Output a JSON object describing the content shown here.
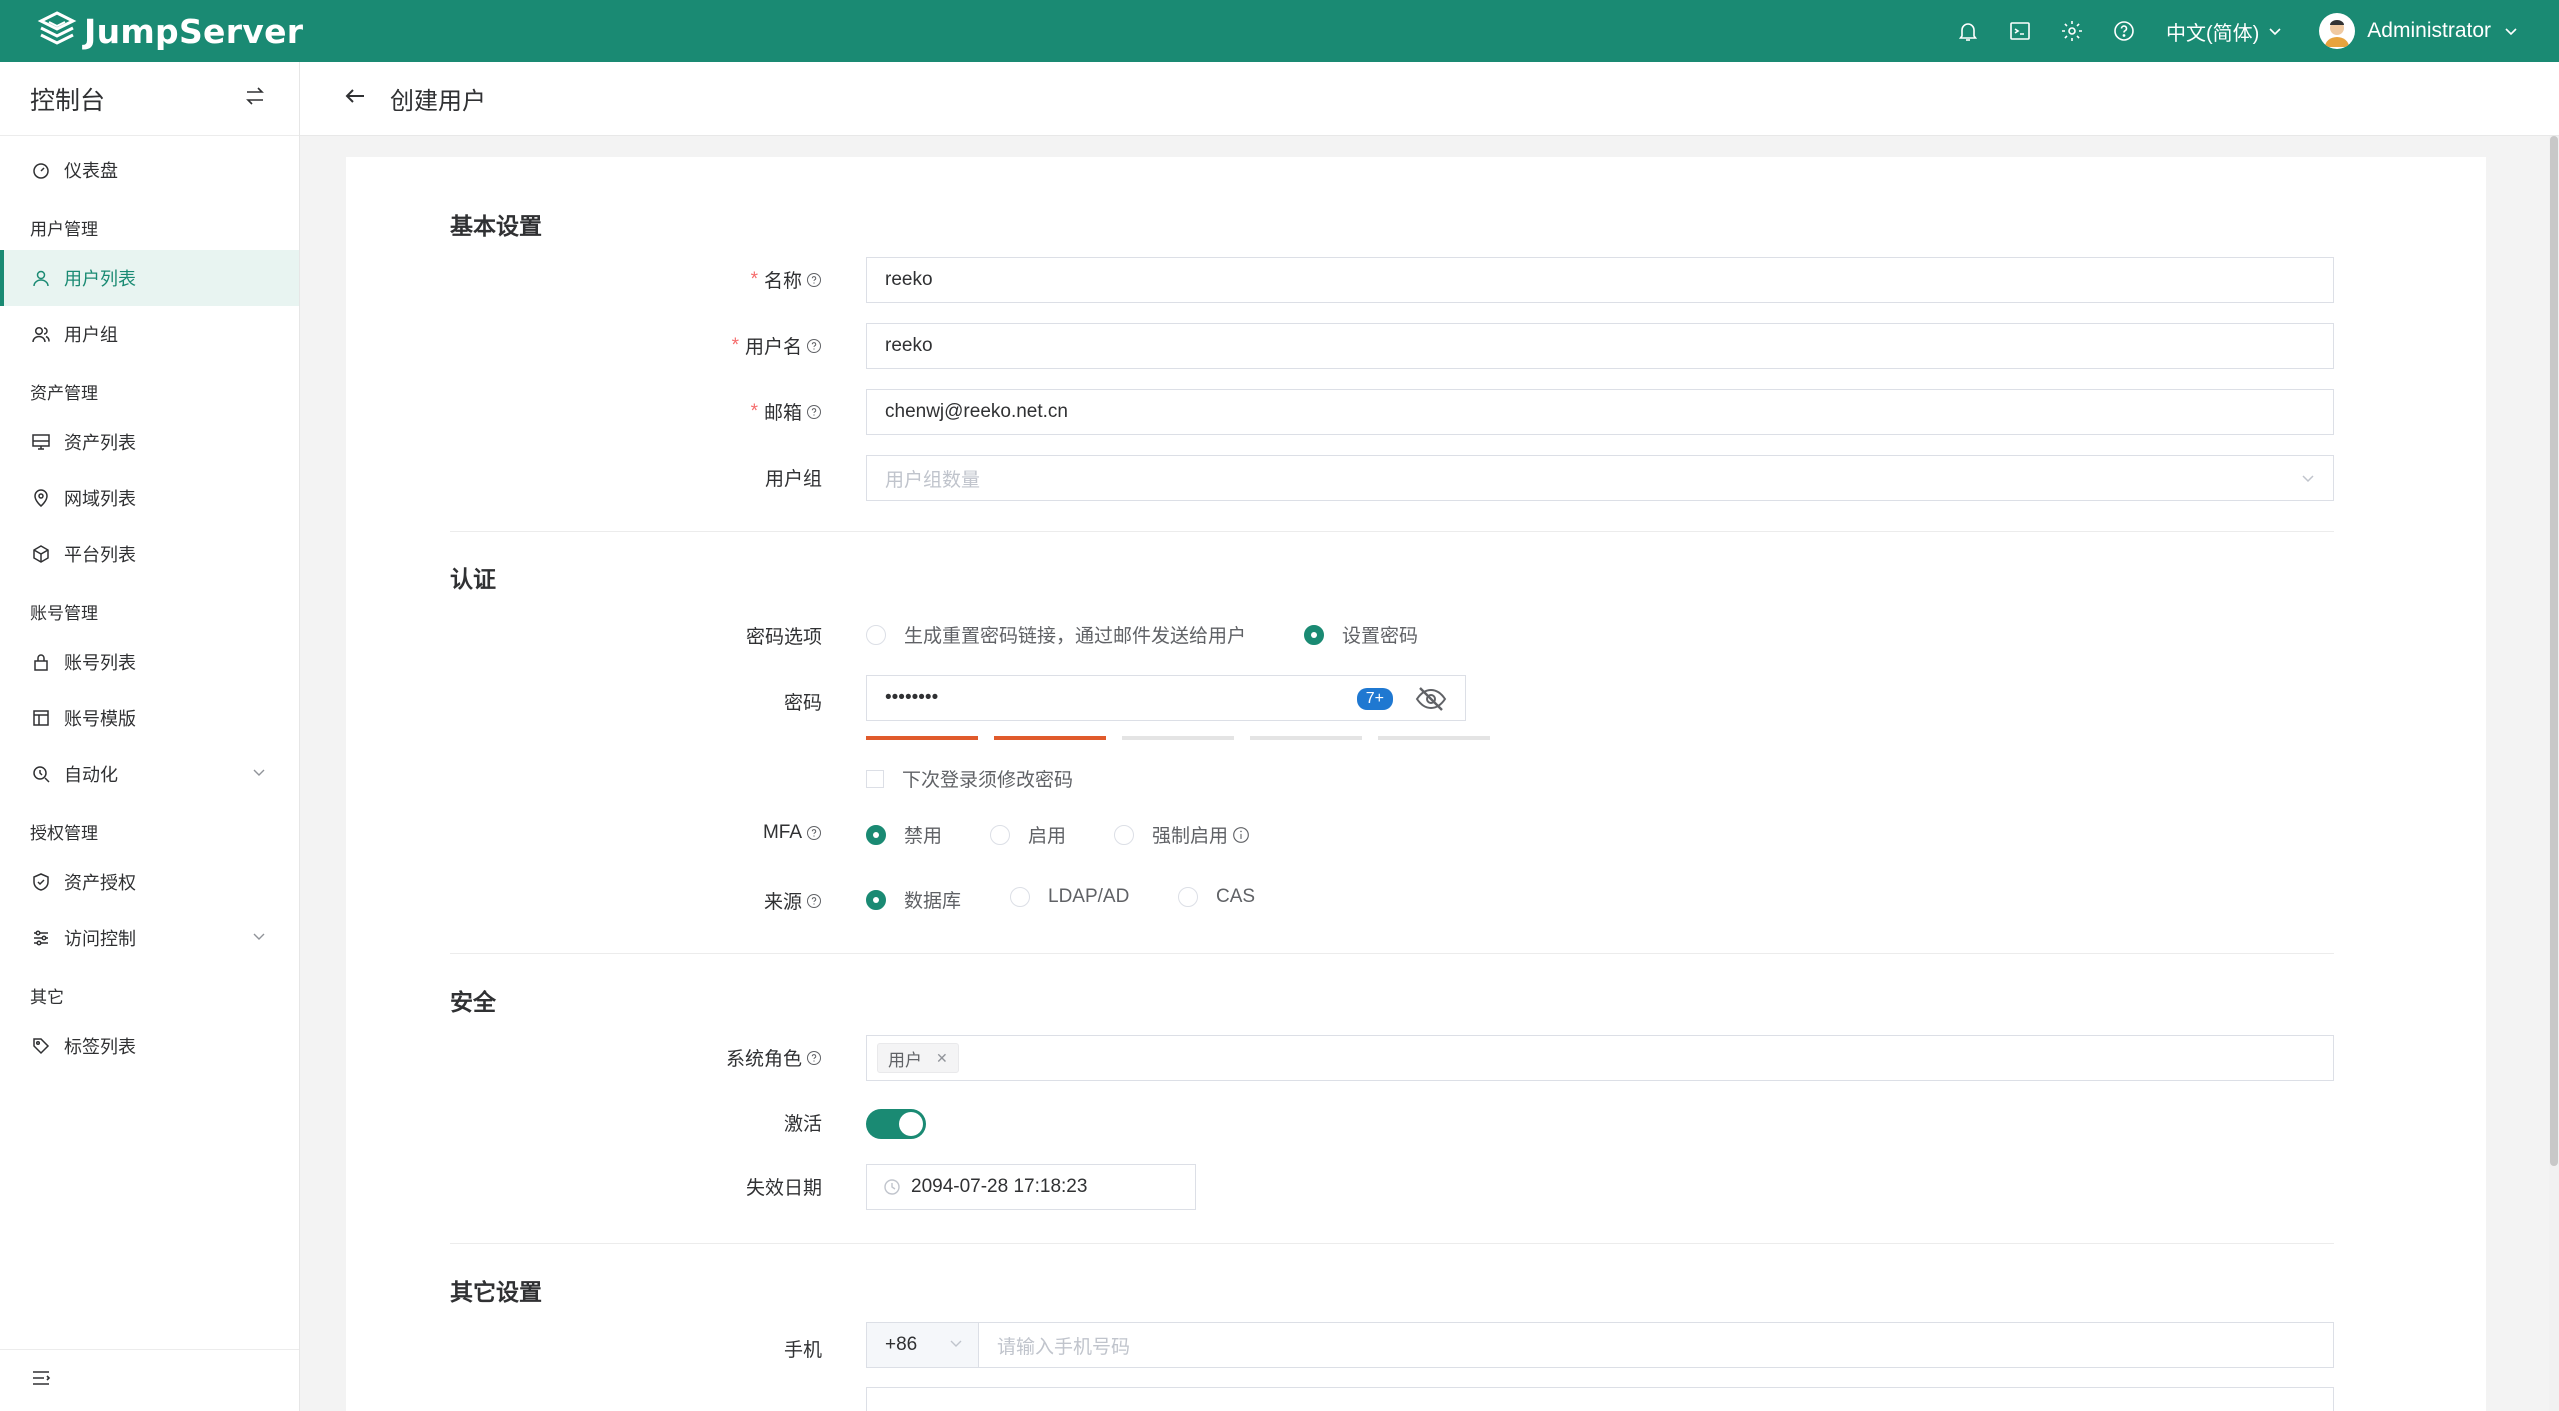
{
  "brand": {
    "name": "JumpServer"
  },
  "topbar": {
    "language": "中文(简体)",
    "username": "Administrator"
  },
  "sidebar": {
    "title": "控制台",
    "items": [
      {
        "type": "item",
        "label": "仪表盘",
        "icon": "dashboard-icon"
      },
      {
        "type": "group",
        "label": "用户管理"
      },
      {
        "type": "item",
        "label": "用户列表",
        "icon": "user-icon",
        "active": true
      },
      {
        "type": "item",
        "label": "用户组",
        "icon": "users-icon"
      },
      {
        "type": "group",
        "label": "资产管理"
      },
      {
        "type": "item",
        "label": "资产列表",
        "icon": "monitor-icon"
      },
      {
        "type": "item",
        "label": "网域列表",
        "icon": "location-icon"
      },
      {
        "type": "item",
        "label": "平台列表",
        "icon": "cube-icon"
      },
      {
        "type": "group",
        "label": "账号管理"
      },
      {
        "type": "item",
        "label": "账号列表",
        "icon": "lock-icon"
      },
      {
        "type": "item",
        "label": "账号模版",
        "icon": "template-icon"
      },
      {
        "type": "item",
        "label": "自动化",
        "icon": "automation-icon",
        "expandable": true
      },
      {
        "type": "group",
        "label": "授权管理"
      },
      {
        "type": "item",
        "label": "资产授权",
        "icon": "shield-icon"
      },
      {
        "type": "item",
        "label": "访问控制",
        "icon": "sliders-icon",
        "expandable": true
      },
      {
        "type": "group",
        "label": "其它"
      },
      {
        "type": "item",
        "label": "标签列表",
        "icon": "tag-icon"
      }
    ]
  },
  "page": {
    "title": "创建用户"
  },
  "form": {
    "sections": {
      "basic": "基本设置",
      "auth": "认证",
      "security": "安全",
      "other": "其它设置"
    },
    "name": {
      "label": "名称",
      "value": "reeko"
    },
    "username": {
      "label": "用户名",
      "value": "reeko"
    },
    "email": {
      "label": "邮箱",
      "value": "chenwj@reeko.net.cn"
    },
    "groups": {
      "label": "用户组",
      "placeholder": "用户组数量"
    },
    "password_option": {
      "label": "密码选项",
      "options": [
        "生成重置密码链接，通过邮件发送给用户",
        "设置密码"
      ],
      "selected": 1
    },
    "password": {
      "label": "密码",
      "masked": "••••••••",
      "badge": "7+",
      "strength_level": 2,
      "strength_max": 5
    },
    "must_change": {
      "label": "下次登录须修改密码",
      "checked": false
    },
    "mfa": {
      "label": "MFA",
      "options": [
        "禁用",
        "启用",
        "强制启用"
      ],
      "selected": 0
    },
    "source": {
      "label": "来源",
      "options": [
        "数据库",
        "LDAP/AD",
        "CAS"
      ],
      "selected": 0
    },
    "system_role": {
      "label": "系统角色",
      "tags": [
        "用户"
      ]
    },
    "active": {
      "label": "激活",
      "on": true
    },
    "expire": {
      "label": "失效日期",
      "value": "2094-07-28 17:18:23"
    },
    "phone": {
      "label": "手机",
      "code": "+86",
      "placeholder": "请输入手机号码"
    }
  },
  "colors": {
    "brand": "#1a8a73",
    "required": "#f56c6c",
    "strength": "#e05a2b",
    "badge": "#1f78d1"
  }
}
